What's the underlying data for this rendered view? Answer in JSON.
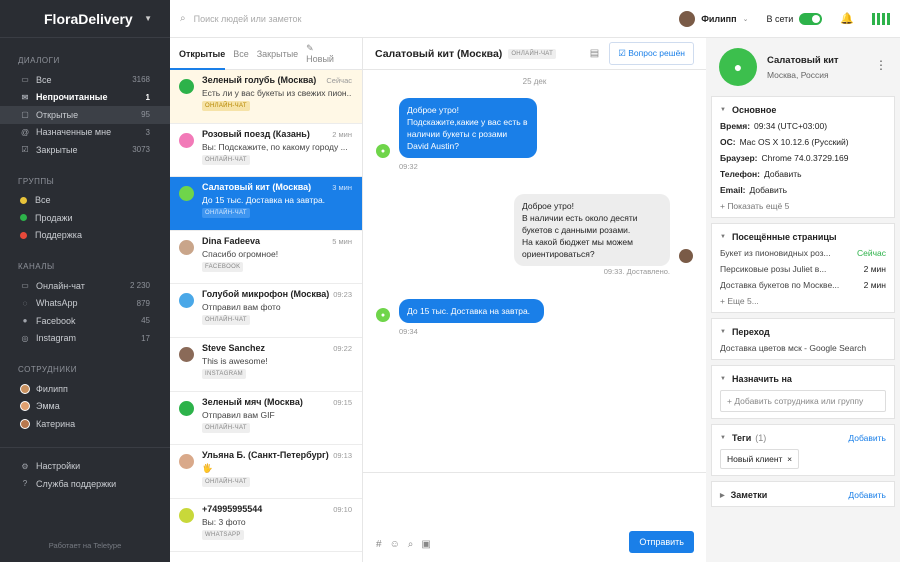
{
  "brand": "FloraDelivery",
  "search": {
    "placeholder": "Поиск людей или заметок"
  },
  "user": {
    "name": "Филипп",
    "status": "В сети"
  },
  "sidebar": {
    "dialogs_title": "ДИАЛОГИ",
    "dialogs": [
      {
        "label": "Все",
        "count": "3168",
        "icon": "inbox-icon"
      },
      {
        "label": "Непрочитанные",
        "count": "1",
        "icon": "envelope-icon"
      },
      {
        "label": "Открытые",
        "count": "95",
        "icon": "chat-icon"
      },
      {
        "label": "Назначенные мне",
        "count": "3",
        "icon": "at-icon"
      },
      {
        "label": "Закрытые",
        "count": "3073",
        "icon": "check-icon"
      }
    ],
    "groups_title": "ГРУППЫ",
    "groups": [
      {
        "label": "Все",
        "color": "#e8c33a"
      },
      {
        "label": "Продажи",
        "color": "#2db24a"
      },
      {
        "label": "Поддержка",
        "color": "#e8493a"
      }
    ],
    "channels_title": "КАНАЛЫ",
    "channels": [
      {
        "label": "Онлайн-чат",
        "count": "2 230",
        "icon": "chat-icon"
      },
      {
        "label": "WhatsApp",
        "count": "879",
        "icon": "whatsapp-icon"
      },
      {
        "label": "Facebook",
        "count": "45",
        "icon": "facebook-icon"
      },
      {
        "label": "Instagram",
        "count": "17",
        "icon": "instagram-icon"
      }
    ],
    "staff_title": "СОТРУДНИКИ",
    "staff": [
      {
        "label": "Филипп"
      },
      {
        "label": "Эмма"
      },
      {
        "label": "Катерина"
      }
    ],
    "settings": "Настройки",
    "support": "Служба поддержки",
    "footer": "Работает на   Teletype"
  },
  "tabs": {
    "open": "Открытые",
    "all": "Все",
    "closed": "Закрытые",
    "new": "Новый"
  },
  "conversations": [
    {
      "name": "Зеленый голубь (Москва)",
      "time": "Сейчас",
      "preview": "Есть ли у вас букеты из свежих пион...",
      "badge": "ОНЛАЙН-ЧАТ",
      "color": "#2db24a"
    },
    {
      "name": "Розовый поезд (Казань)",
      "time": "2 мин",
      "preview": "Вы: Подскажите, по какому городу ...",
      "badge": "ОНЛАЙН-ЧАТ",
      "color": "#f27ab8"
    },
    {
      "name": "Салатовый кит (Москва)",
      "time": "3 мин",
      "preview": "До 15 тыс. Доставка на завтра.",
      "badge": "ОНЛАЙН-ЧАТ",
      "color": "#6fd54a"
    },
    {
      "name": "Dina Fadeeva",
      "time": "5 мин",
      "preview": "Спасибо огромное!",
      "badge": "FACEBOOK",
      "color": "#c9a58a"
    },
    {
      "name": "Голубой микрофон (Москва)",
      "time": "09:23",
      "preview": "Отправил вам фото",
      "badge": "ОНЛАЙН-ЧАТ",
      "color": "#4aa8e8"
    },
    {
      "name": "Steve Sanchez",
      "time": "09:22",
      "preview": "This is awesome!",
      "badge": "INSTAGRAM",
      "color": "#8a6a58"
    },
    {
      "name": "Зеленый мяч (Москва)",
      "time": "09:15",
      "preview": "Отправил вам GIF",
      "badge": "ОНЛАЙН-ЧАТ",
      "color": "#2db24a"
    },
    {
      "name": "Ульяна Б. (Санкт-Петербург)",
      "time": "09:13",
      "preview": "🖐",
      "badge": "ОНЛАЙН-ЧАТ",
      "color": "#d9a98a"
    },
    {
      "name": "+74995995544",
      "time": "09:10",
      "preview": "Вы: 3 фото",
      "badge": "WHATSAPP",
      "color": "#c8d83a"
    }
  ],
  "chat": {
    "title": "Салатовый кит (Москва)",
    "badge": "ОНЛАЙН-ЧАТ",
    "resolve": "Вопрос решён",
    "date": "25 дек",
    "m1": "Доброе утро!\nПодскажите,какие у вас есть в наличии букеты с розами David Austin?",
    "m1_time": "09:32",
    "m2": "Доброе утро!\nВ наличии есть около десяти букетов с данными розами.\nНа какой бюджет мы можем ориентироваться?",
    "m2_time": "09:33. Доставлено.",
    "m3": "До 15 тыс. Доставка на завтра.",
    "m3_time": "09:34",
    "send": "Отправить"
  },
  "info": {
    "name": "Салатовый кит",
    "location": "Москва, Россия",
    "basic_title": "Основное",
    "time_label": "Время:",
    "time_value": "09:34 (UTC+03:00)",
    "os_label": "ОС:",
    "os_value": "Mac OS X 10.12.6 (Русский)",
    "browser_label": "Браузер:",
    "browser_value": "Chrome 74.0.3729.169",
    "phone_label": "Телефон:",
    "phone_value": "Добавить",
    "email_label": "Email:",
    "email_value": "Добавить",
    "show_more": "+ Показать ещё 5",
    "pages_title": "Посещённые страницы",
    "pages": [
      {
        "page": "Букет из пионовидных роз...",
        "time": "Сейчас"
      },
      {
        "page": "Персиковые розы Juliet в...",
        "time": "2 мин"
      },
      {
        "page": "Доставка букетов по Москве...",
        "time": "2 мин"
      }
    ],
    "pages_more": "+ Еще 5...",
    "transition_title": "Переход",
    "transition_value": "Доставка цветов мск - Google Search",
    "assign_title": "Назначить на",
    "assign_placeholder": "+ Добавить сотрудника или группу",
    "tags_title": "Теги",
    "tags_count": "(1)",
    "tags_add": "Добавить",
    "tag": "Новый клиент",
    "notes_title": "Заметки",
    "notes_add": "Добавить"
  }
}
